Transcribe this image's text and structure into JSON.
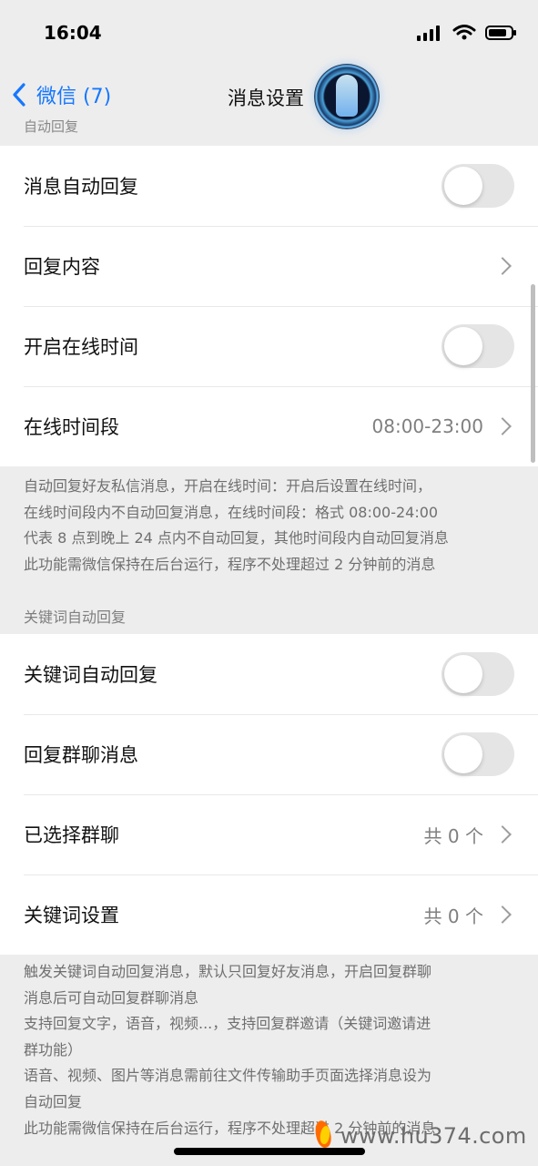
{
  "status": {
    "time": "16:04"
  },
  "nav": {
    "back_label": "微信 (7)",
    "title": "消息设置"
  },
  "sections": {
    "auto_reply_label": "自动回复",
    "keyword_label": "关键词自动回复"
  },
  "group1": {
    "items": [
      {
        "label": "消息自动回复",
        "type": "toggle",
        "state": "off"
      },
      {
        "label": "回复内容",
        "type": "chevron"
      },
      {
        "label": "开启在线时间",
        "type": "toggle",
        "state": "off"
      },
      {
        "label": "在线时间段",
        "value": "08:00-23:00",
        "type": "chevron"
      }
    ]
  },
  "desc1": "自动回复好友私信消息，开启在线时间：开启后设置在线时间，\n在线时间段内不自动回复消息，在线时间段：格式 08:00-24:00\n代表 8 点到晚上 24 点内不自动回复，其他时间段内自动回复消息\n此功能需微信保持在后台运行，程序不处理超过 2 分钟前的消息",
  "group2": {
    "items": [
      {
        "label": "关键词自动回复",
        "type": "toggle",
        "state": "off"
      },
      {
        "label": "回复群聊消息",
        "type": "toggle",
        "state": "off"
      },
      {
        "label": "已选择群聊",
        "value": "共 0 个",
        "type": "chevron"
      },
      {
        "label": "关键词设置",
        "value": "共 0 个",
        "type": "chevron"
      }
    ]
  },
  "desc2": "触发关键词自动回复消息，默认只回复好友消息，开启回复群聊\n消息后可自动回复群聊消息\n支持回复文字，语音，视频...，支持回复群邀请（关键词邀请进\n群功能）\n语音、视频、图片等消息需前往文件传输助手页面选择消息设为\n自动回复\n此功能需微信保持在后台运行，程序不处理超过 2 分钟前的消息",
  "watermark": "www.hu374.com",
  "colors": {
    "accent": "#1677FF",
    "background": "#EDEDED",
    "toggle_off": "#E5E5E5"
  },
  "icons": {
    "back": "chevron-left-icon",
    "signal": "signal-icon",
    "wifi": "wifi-icon",
    "battery": "battery-icon",
    "avatar": "profile-avatar"
  }
}
